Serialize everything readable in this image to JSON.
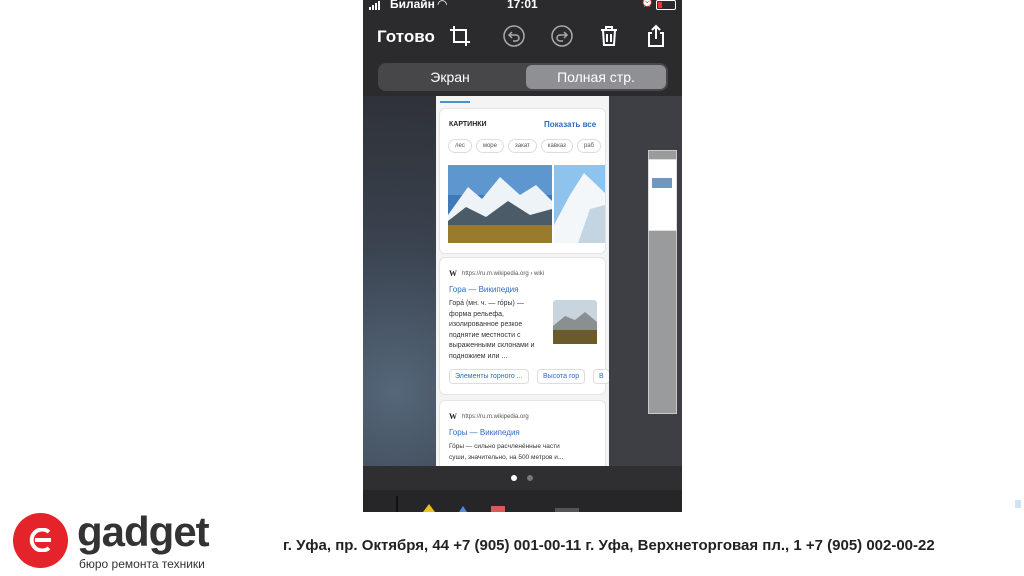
{
  "status_bar": {
    "carrier": "Билайн",
    "time": "17:01"
  },
  "toolbar": {
    "done_label": "Готово"
  },
  "segmented": {
    "screen": "Экран",
    "full_page": "Полная стр."
  },
  "preview": {
    "images": {
      "title": "КАРТИНКИ",
      "more": "Показать все",
      "chips": [
        "лес",
        "море",
        "закат",
        "кавказ",
        "раб"
      ]
    },
    "result1": {
      "source_icon": "W",
      "source": "https://ru.m.wikipedia.org › wiki",
      "title": "Гора — Википедия",
      "snippet_lines": [
        "Гора́ (мн. ч. — го́ры) —",
        "форма рельефа,",
        "изолированное резкое",
        "поднятие местности с",
        "выраженными склонами и",
        "подножием или ..."
      ],
      "links": [
        "Элементы горного ...",
        "Высота гор",
        "В"
      ]
    },
    "result2": {
      "source_icon": "W",
      "source": "https://ru.m.wikipedia.org",
      "title": "Горы — Википедия",
      "snippet_lines": [
        "Го́ры — сильно расчленённые части",
        "суши, значительно, на 500 метров и..."
      ]
    }
  },
  "footer": {
    "brand": "gadget",
    "tagline": "бюро ремонта техники",
    "address": "г. Уфа, пр. Октября, 44   +7 (905) 001-00-11 г. Уфа, Верхнеторговая пл., 1  +7 (905) 002-00-22"
  },
  "colors": {
    "accent_red": "#e4232b",
    "link_blue": "#2d6cc4"
  }
}
